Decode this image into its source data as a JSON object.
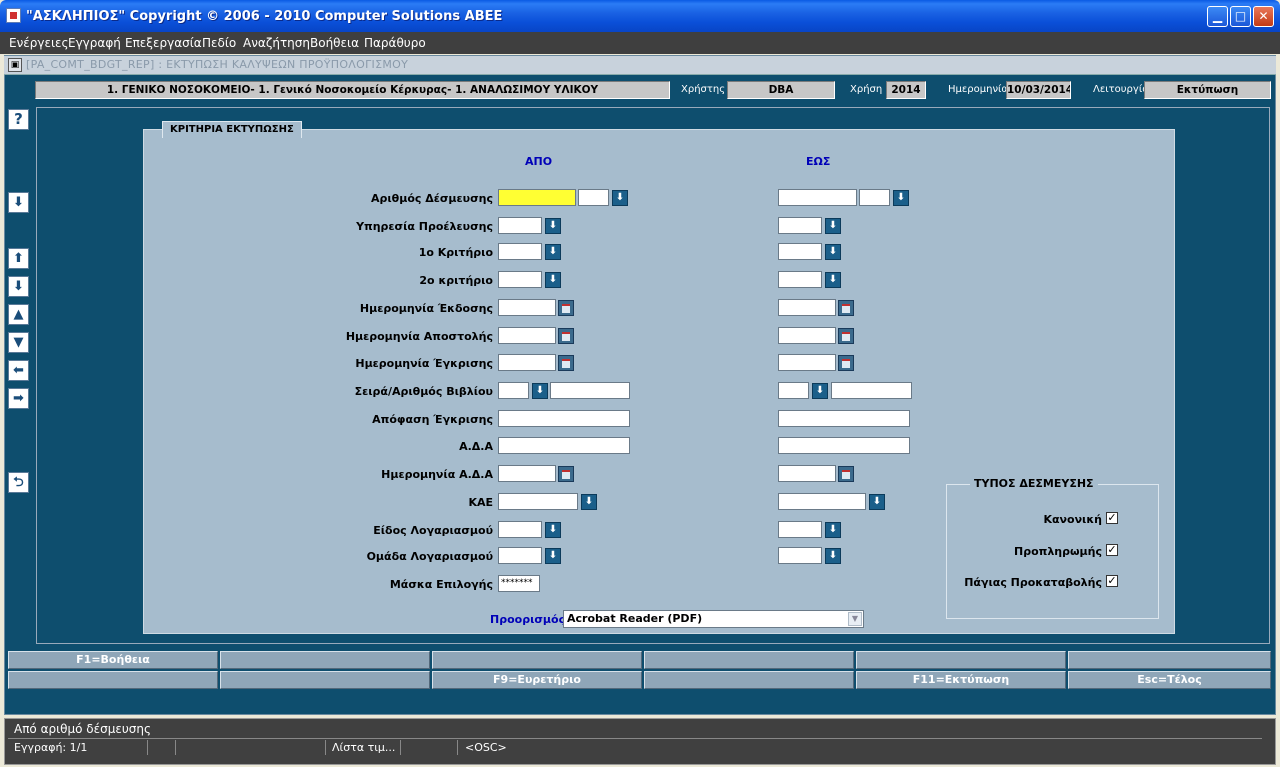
{
  "window": {
    "title": "\"ΑΣΚΛΗΠΙΟΣ\" Copyright © 2006 - 2010 Computer Solutions ΑΒΕΕ",
    "minimize": "▁",
    "maximize": "□",
    "close": "✕"
  },
  "menu": [
    "Ενέργειες",
    "Εγγραφή",
    "Επεξεργασία",
    "Πεδίο",
    "Αναζήτηση",
    "Βοήθεια",
    "Παράθυρο"
  ],
  "form": {
    "title": "[PA_COMT_BDGT_REP]   :  ΕΚΤΥΠΩΣΗ ΚΑΛΥΨΕΩΝ ΠΡΟΫΠΟΛΟΓΙΣΜΟΥ",
    "header": {
      "organization": "1. ΓΕΝΙΚΟ ΝΟΣΟΚΟΜΕΙΟ- 1. Γενικό Νοσοκομείο Κέρκυρας- 1. ΑΝΑΛΩΣΙΜΟΥ ΥΛΙΚΟΥ",
      "user_label": "Χρήστης",
      "user_value": "DBA",
      "year_label": "Χρήση",
      "year_value": "2014",
      "date_label": "Ημερομηνία",
      "date_value": "10/03/2014",
      "mode_label": "Λειτουργία",
      "mode_value": "Εκτύπωση"
    },
    "toolbar": {
      "help": "?",
      "down": "⬇",
      "first": "⬆",
      "last": "⬇",
      "prev": "▲",
      "next": "▼",
      "left": "⬅",
      "right": "➡",
      "back": "⮌"
    },
    "panel_title": "ΚΡΙΤΗΡΙΑ ΕΚΤΥΠΩΣΗΣ",
    "col_from": "ΑΠΟ",
    "col_to": "ΕΩΣ",
    "labels": {
      "commitment_no": "Αριθμός Δέσμευσης",
      "origin_service": "Υπηρεσία Προέλευσης",
      "criterion1": "1ο Κριτήριο",
      "criterion2": "2ο κριτήριο",
      "issue_date": "Ημερομηνία Έκδοσης",
      "send_date": "Ημερομηνία Αποστολής",
      "approval_date": "Ημερομηνία Έγκρισης",
      "book_series": "Σειρά/Αριθμός Βιβλίου",
      "approval_decision": "Απόφαση Έγκρισης",
      "ada": "Α.Δ.Α",
      "ada_date": "Ημερομηνία Α.Δ.Α",
      "kae": "ΚΑΕ",
      "account_type": "Είδος Λογαριασμού",
      "account_group": "Ομάδα Λογαριασμού",
      "selection_mask": "Μάσκα Επιλογής"
    },
    "selection_mask_value": "*******",
    "lov_icon": "⬇",
    "commitment_type": {
      "title": "ΤΥΠΟΣ ΔΕΣΜΕΥΣΗΣ",
      "options": [
        {
          "label": "Κανονική",
          "checked": "✓"
        },
        {
          "label": "Προπληρωμής",
          "checked": "✓"
        },
        {
          "label": "Πάγιας Προκαταβολής",
          "checked": "✓"
        }
      ]
    },
    "destination_label": "Προορισμός",
    "destination_value": "Acrobat Reader (PDF)",
    "destination_arrow": "▼"
  },
  "fkeys_row1": [
    "F1=Βοήθεια",
    "",
    "",
    "",
    "",
    ""
  ],
  "fkeys_row2": [
    "",
    "",
    "F9=Ευρετήριο",
    "",
    "F11=Εκτύπωση",
    "Esc=Τέλος"
  ],
  "status": {
    "message": "Από αριθμό δέσμευσης",
    "record": "Εγγραφή: 1/1",
    "list": "Λίστα τιμ...",
    "osc": "<OSC>"
  }
}
